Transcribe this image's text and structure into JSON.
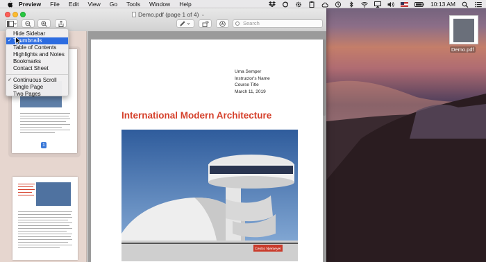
{
  "menubar": {
    "app": "Preview",
    "items": [
      "File",
      "Edit",
      "View",
      "Go",
      "Tools",
      "Window",
      "Help"
    ],
    "clock": "10:13 AM"
  },
  "window": {
    "title": "Demo.pdf (page 1 of 4)",
    "search_placeholder": "Search"
  },
  "view_menu": {
    "items": [
      {
        "label": "Hide Sidebar",
        "checked": false,
        "selected": false
      },
      {
        "label": "Thumbnails",
        "checked": true,
        "selected": true
      },
      {
        "label": "Table of Contents",
        "checked": false,
        "selected": false
      },
      {
        "label": "Highlights and Notes",
        "checked": false,
        "selected": false
      },
      {
        "label": "Bookmarks",
        "checked": false,
        "selected": false
      },
      {
        "label": "Contact Sheet",
        "checked": false,
        "selected": false
      },
      {
        "label": "Continuous Scroll",
        "checked": true,
        "selected": false
      },
      {
        "label": "Single Page",
        "checked": false,
        "selected": false
      },
      {
        "label": "Two Pages",
        "checked": false,
        "selected": false
      }
    ]
  },
  "sidebar": {
    "page_badge": "1"
  },
  "document": {
    "author_lines": [
      "Uma Semper",
      "Instructor's Name",
      "Course Title",
      "March 11, 2019"
    ],
    "heading": "International Modern Architecture",
    "photo_caption": "Centro Niemeyer"
  },
  "desktop": {
    "file_name": "Demo.pdf"
  },
  "colors": {
    "heading": "#d5402b",
    "selection": "#2d6ce0",
    "badge": "#3b79d8"
  }
}
